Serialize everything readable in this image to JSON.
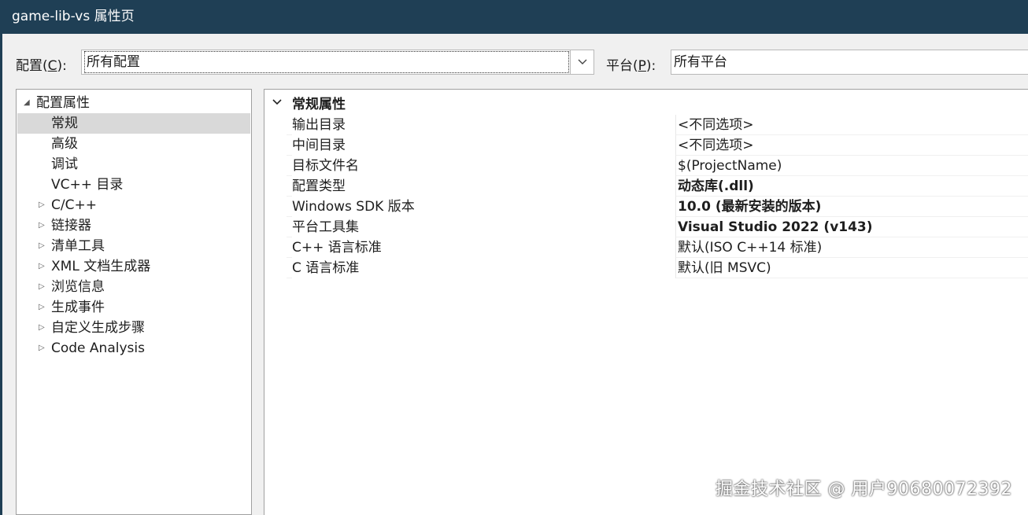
{
  "window": {
    "title": "game-lib-vs 属性页"
  },
  "config": {
    "config_label": "配置(",
    "config_key": "C",
    "config_tail": "):",
    "config_value": "所有配置",
    "platform_label": "平台(",
    "platform_key": "P",
    "platform_tail": "):",
    "platform_value": "所有平台"
  },
  "tree": {
    "root": "配置属性",
    "items": [
      {
        "label": "常规",
        "selected": true,
        "expandable": false
      },
      {
        "label": "高级",
        "expandable": false
      },
      {
        "label": "调试",
        "expandable": false
      },
      {
        "label": "VC++ 目录",
        "expandable": false
      },
      {
        "label": "C/C++",
        "expandable": true
      },
      {
        "label": "链接器",
        "expandable": true
      },
      {
        "label": "清单工具",
        "expandable": true
      },
      {
        "label": "XML 文档生成器",
        "expandable": true
      },
      {
        "label": "浏览信息",
        "expandable": true
      },
      {
        "label": "生成事件",
        "expandable": true
      },
      {
        "label": "自定义生成步骤",
        "expandable": true
      },
      {
        "label": "Code Analysis",
        "expandable": true
      }
    ]
  },
  "grid": {
    "category": "常规属性",
    "rows": [
      {
        "name": "输出目录",
        "value": "<不同选项>",
        "bold": false
      },
      {
        "name": "中间目录",
        "value": "<不同选项>",
        "bold": false
      },
      {
        "name": "目标文件名",
        "value": "$(ProjectName)",
        "bold": false
      },
      {
        "name": "配置类型",
        "value": "动态库(.dll)",
        "bold": true
      },
      {
        "name": "Windows SDK 版本",
        "value": "10.0 (最新安装的版本)",
        "bold": true
      },
      {
        "name": "平台工具集",
        "value": "Visual Studio 2022 (v143)",
        "bold": true
      },
      {
        "name": "C++ 语言标准",
        "value": "默认(ISO C++14 标准)",
        "bold": false
      },
      {
        "name": "C 语言标准",
        "value": "默认(旧 MSVC)",
        "bold": false
      }
    ]
  },
  "watermark": "掘金技术社区 @ 用户90680072392"
}
